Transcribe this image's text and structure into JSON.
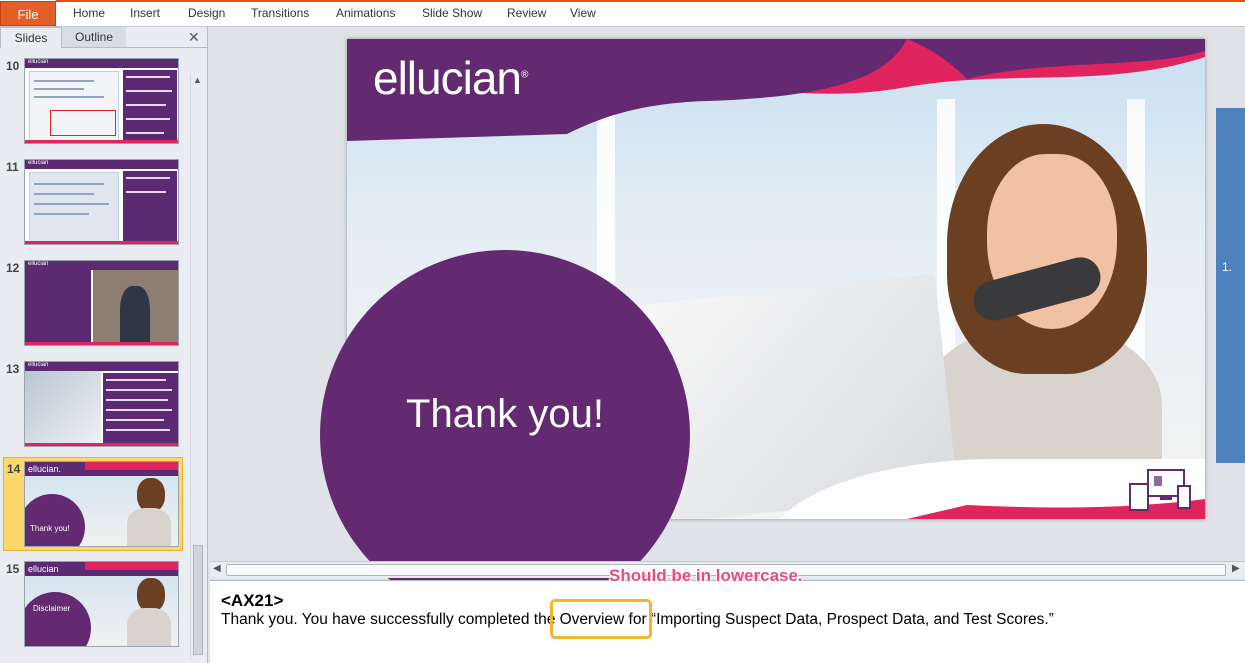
{
  "ribbon": {
    "file_label": "File",
    "tabs": [
      "Home",
      "Insert",
      "Design",
      "Transitions",
      "Animations",
      "Slide Show",
      "Review",
      "View"
    ]
  },
  "panel": {
    "tab_slides": "Slides",
    "tab_outline": "Outline",
    "close_icon": "✕",
    "thumbnails": [
      {
        "number": "10",
        "logo": "ellucian"
      },
      {
        "number": "11",
        "logo": "ellucian"
      },
      {
        "number": "12",
        "logo": "ellucian"
      },
      {
        "number": "13",
        "logo": "ellucian"
      },
      {
        "number": "14",
        "logo": "ellucian.",
        "caption": "Thank you!"
      },
      {
        "number": "15",
        "logo": "ellucian",
        "caption": "Disclaimer"
      }
    ]
  },
  "slide": {
    "logo": "ellucian",
    "logo_mark": "®",
    "heading": "Thank you!",
    "colors": {
      "purple": "#632a72",
      "magenta": "#e0245e"
    }
  },
  "next_slide_label": "1.",
  "notes": {
    "code": "<AX21>",
    "text": "Thank you. You have successfully completed the Overview for “Importing Suspect Data, Prospect Data, and Test Scores.”"
  },
  "annotation": {
    "callout": "Should be in lowercase.",
    "highlight_color": "#f2b530"
  }
}
